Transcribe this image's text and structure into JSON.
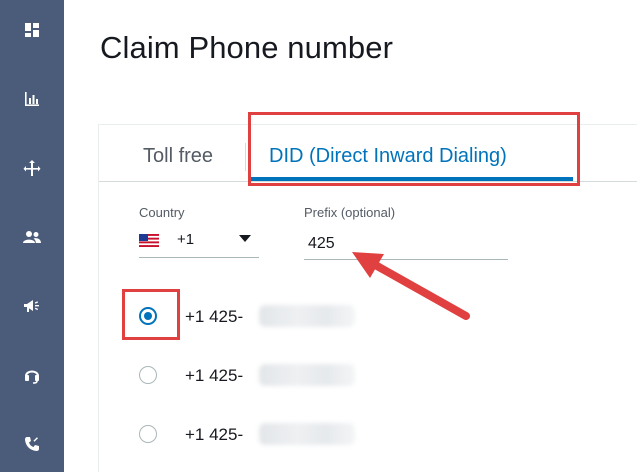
{
  "page": {
    "title": "Claim Phone number"
  },
  "rail": {
    "items": [
      {
        "name": "dashboard",
        "icon": "dashboard-icon"
      },
      {
        "name": "metrics",
        "icon": "bar-chart-icon"
      },
      {
        "name": "routing",
        "icon": "routing-icon"
      },
      {
        "name": "users",
        "icon": "users-icon"
      },
      {
        "name": "campaigns",
        "icon": "megaphone-icon"
      },
      {
        "name": "channels",
        "icon": "headset-icon"
      },
      {
        "name": "phone",
        "icon": "phone-icon"
      }
    ]
  },
  "tabs": [
    {
      "label": "Toll free",
      "active": false
    },
    {
      "label": "DID (Direct Inward Dialing)",
      "active": true
    }
  ],
  "country": {
    "label": "Country",
    "value": "+1",
    "flag": "us-flag-icon"
  },
  "prefix": {
    "label": "Prefix (optional)",
    "value": "425"
  },
  "numbers": [
    {
      "text": "+1 425-",
      "selected": true
    },
    {
      "text": "+1 425-",
      "selected": false
    },
    {
      "text": "+1 425-",
      "selected": false
    }
  ],
  "colors": {
    "accent": "#0073bb",
    "highlight": "#e0403f",
    "rail": "#4b5c7a"
  }
}
